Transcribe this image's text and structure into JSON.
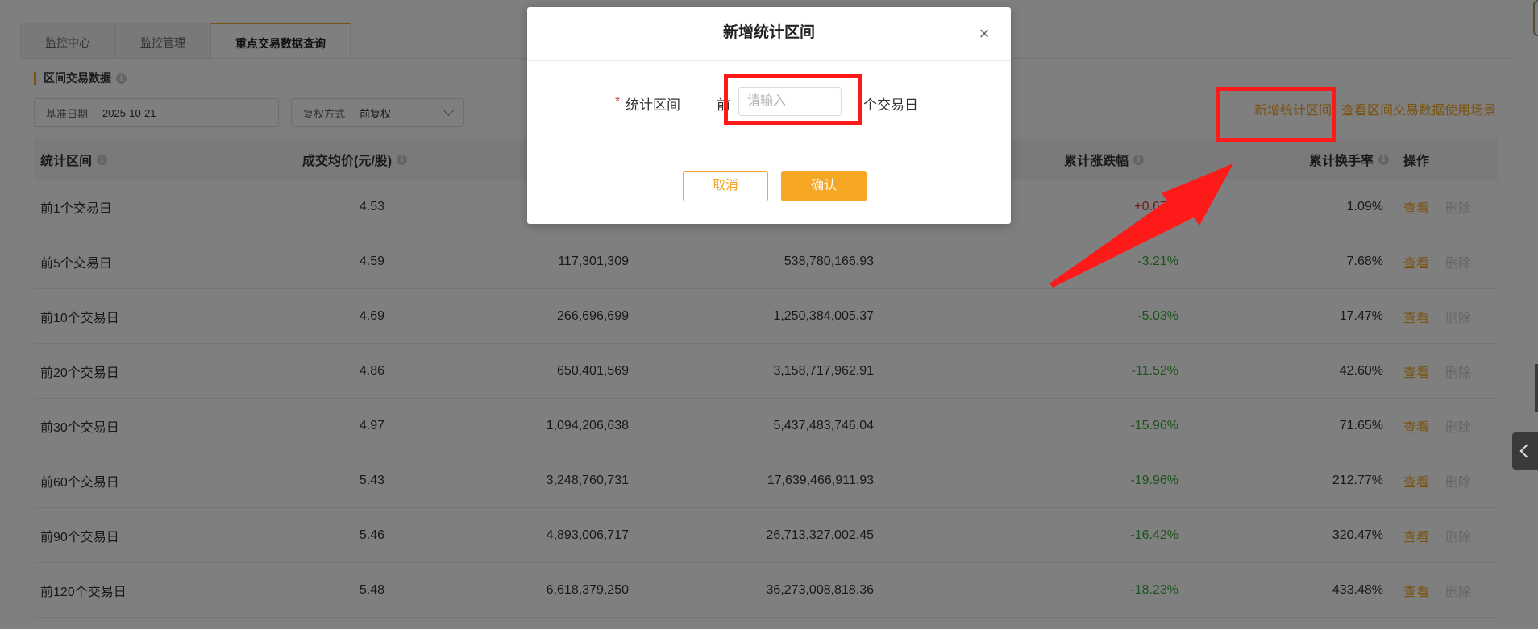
{
  "tabs": [
    "监控中心",
    "监控管理",
    "重点交易数据查询"
  ],
  "active_tab": 2,
  "section_title": "区间交易数据",
  "filters": {
    "base_date_label": "基准日期",
    "base_date_value": "2025-10-21",
    "adjust_label": "复权方式",
    "adjust_value": "前复权"
  },
  "top_links": {
    "add_interval": "新增统计区间",
    "view_scenarios": "查看区间交易数据使用场景"
  },
  "table": {
    "headers": [
      "统计区间",
      "成交均价(元/股)",
      "",
      "",
      "累计涨跌幅",
      "累计换手率",
      "操作"
    ],
    "view_label": "查看",
    "delete_label": "删除",
    "rows": [
      {
        "interval": "前1个交易日",
        "avg_price": "4.53",
        "volume": "",
        "amount": "",
        "change": "+0.67%",
        "dir": "up",
        "turnover": "1.09%"
      },
      {
        "interval": "前5个交易日",
        "avg_price": "4.59",
        "volume": "117,301,309",
        "amount": "538,780,166.93",
        "change": "-3.21%",
        "dir": "down",
        "turnover": "7.68%"
      },
      {
        "interval": "前10个交易日",
        "avg_price": "4.69",
        "volume": "266,696,699",
        "amount": "1,250,384,005.37",
        "change": "-5.03%",
        "dir": "down",
        "turnover": "17.47%"
      },
      {
        "interval": "前20个交易日",
        "avg_price": "4.86",
        "volume": "650,401,569",
        "amount": "3,158,717,962.91",
        "change": "-11.52%",
        "dir": "down",
        "turnover": "42.60%"
      },
      {
        "interval": "前30个交易日",
        "avg_price": "4.97",
        "volume": "1,094,206,638",
        "amount": "5,437,483,746.04",
        "change": "-15.96%",
        "dir": "down",
        "turnover": "71.65%"
      },
      {
        "interval": "前60个交易日",
        "avg_price": "5.43",
        "volume": "3,248,760,731",
        "amount": "17,639,466,911.93",
        "change": "-19.96%",
        "dir": "down",
        "turnover": "212.77%"
      },
      {
        "interval": "前90个交易日",
        "avg_price": "5.46",
        "volume": "4,893,006,717",
        "amount": "26,713,327,002.45",
        "change": "-16.42%",
        "dir": "down",
        "turnover": "320.47%"
      },
      {
        "interval": "前120个交易日",
        "avg_price": "5.48",
        "volume": "6,618,379,250",
        "amount": "36,273,008,818.36",
        "change": "-18.23%",
        "dir": "down",
        "turnover": "433.48%"
      }
    ]
  },
  "modal": {
    "title": "新增统计区间",
    "close": "×",
    "required_mark": "*",
    "field_label": "统计区间",
    "prefix": "前",
    "input_placeholder": "请输入",
    "input_value": "",
    "suffix": "个交易日",
    "cancel": "取消",
    "confirm": "确认"
  },
  "colors": {
    "accent": "#f5a623",
    "up": "#e53935",
    "down": "#3aa93a",
    "highlight": "#ff1a1a"
  },
  "icons": [
    "info-icon",
    "chevron-down-icon",
    "close-icon",
    "chevron-left-icon",
    "annotation-arrow"
  ]
}
